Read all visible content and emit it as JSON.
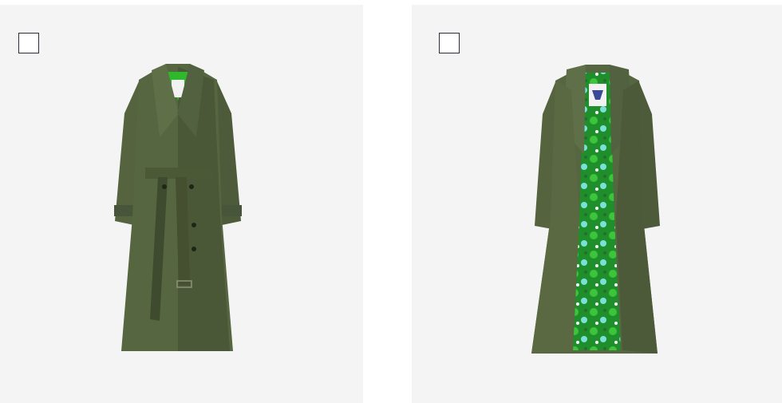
{
  "gallery": {
    "items": [
      {
        "image": "trench-coat-front-belted",
        "coat_color": "#4f5f3c",
        "select_checked": false
      },
      {
        "image": "trench-coat-open-floral-lining",
        "coat_color": "#4f5f3c",
        "lining_colors": [
          "#1e8f2a",
          "#3cc43a",
          "#7ae0d8",
          "#2a6b2e"
        ],
        "select_checked": false
      }
    ]
  }
}
